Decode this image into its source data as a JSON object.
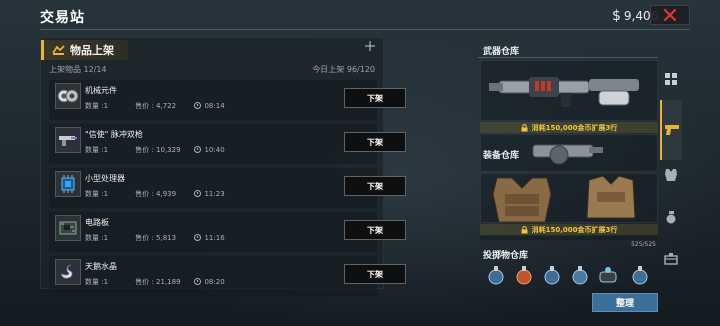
{
  "header": {
    "title": "交易站",
    "currency_symbol": "$",
    "money": "9,406"
  },
  "listing": {
    "tab_label": "物品上架",
    "listed_label": "上架物品 12/14",
    "today_label": "今日上架 96/120",
    "items": [
      {
        "name": "机械元件",
        "qty": "数量 :1",
        "price": "售价 : 4,722",
        "time": "08:14",
        "button": "下架"
      },
      {
        "name": "\"信使\" 脉冲双枪",
        "qty": "数量 :1",
        "price": "售价 : 10,329",
        "time": "10:40",
        "button": "下架"
      },
      {
        "name": "小型处理器",
        "qty": "数量 :1",
        "price": "售价 : 4,939",
        "time": "11:23",
        "button": "下架"
      },
      {
        "name": "电路板",
        "qty": "数量 :1",
        "price": "售价 : 5,813",
        "time": "11:16",
        "button": "下架"
      },
      {
        "name": "天鹅水晶",
        "qty": "数量 :1",
        "price": "售价 : 21,189",
        "time": "08:20",
        "button": "下架"
      }
    ]
  },
  "storage": {
    "weapon_title": "武器仓库",
    "weapon_unlock": "消耗150,000金币扩展3行",
    "equipment_title": "装备仓库",
    "equipment_unlock": "消耗150,000金币扩展3行",
    "equipment_count": "525/525",
    "throw_title": "投掷物仓库",
    "sort_button": "整理"
  },
  "colors": {
    "accent": "#e9b23a",
    "unlock_text": "#f2c640",
    "close_red": "#e0342f",
    "sort_button": "#3b6f9a"
  },
  "icons": {
    "close": "close-icon",
    "sell": "sell-tag-icon",
    "lock": "lock-icon",
    "clock": "clock-icon",
    "side_tabs": [
      "grid-icon",
      "pistol-icon",
      "vest-icon",
      "grenade-icon",
      "crate-icon"
    ]
  }
}
